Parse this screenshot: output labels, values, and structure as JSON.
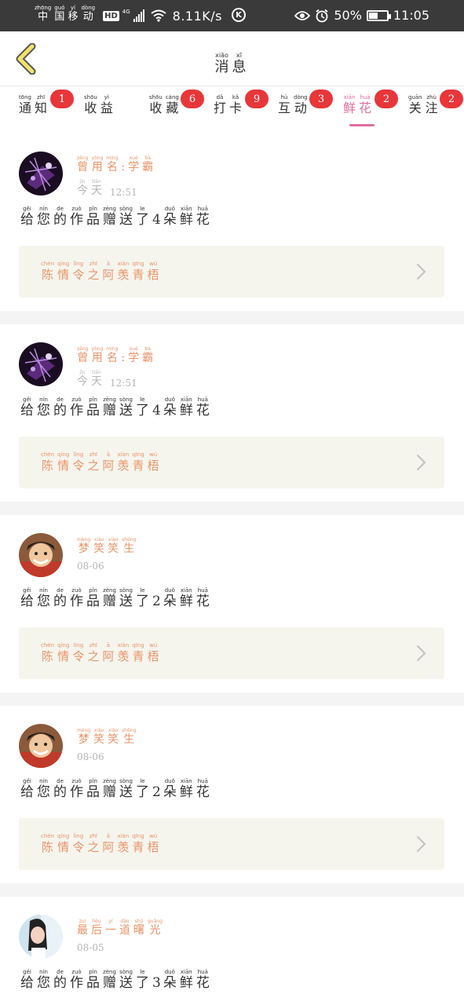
{
  "status_bar": {
    "carrier": [
      {
        "p": "zhōng",
        "h": "中"
      },
      {
        "p": "guó",
        "h": "国"
      },
      {
        "p": "yí",
        "h": "移"
      },
      {
        "p": "dòng",
        "h": "动"
      }
    ],
    "hd": "HD",
    "network": "4G",
    "speed": "8.11K/s",
    "k_icon": "K",
    "battery": "50%",
    "battery_level": 0.5,
    "time": "11:05"
  },
  "header": {
    "title": [
      {
        "p": "xiāo",
        "h": "消"
      },
      {
        "p": "xī",
        "h": "息"
      }
    ]
  },
  "tabs": [
    {
      "chars": [
        {
          "p": "tōng",
          "h": "通"
        },
        {
          "p": "zhī",
          "h": "知"
        }
      ],
      "badge": "1",
      "active": false
    },
    {
      "chars": [
        {
          "p": "shōu",
          "h": "收"
        },
        {
          "p": "yì",
          "h": "益"
        }
      ],
      "badge": "",
      "active": false
    },
    {
      "chars": [
        {
          "p": "shōu",
          "h": "收"
        },
        {
          "p": "cáng",
          "h": "藏"
        }
      ],
      "badge": "6",
      "active": false
    },
    {
      "chars": [
        {
          "p": "dǎ",
          "h": "打"
        },
        {
          "p": "kǎ",
          "h": "卡"
        }
      ],
      "badge": "9",
      "active": false
    },
    {
      "chars": [
        {
          "p": "hù",
          "h": "互"
        },
        {
          "p": "dòng",
          "h": "动"
        }
      ],
      "badge": "3",
      "active": false
    },
    {
      "chars": [
        {
          "p": "xiān",
          "h": "鲜"
        },
        {
          "p": "huā",
          "h": "花"
        }
      ],
      "badge": "2",
      "active": true
    },
    {
      "chars": [
        {
          "p": "guān",
          "h": "关"
        },
        {
          "p": "zhù",
          "h": "注"
        }
      ],
      "badge": "2",
      "active": false
    }
  ],
  "messages": [
    {
      "avatar": "avatar-purple",
      "name": [
        {
          "p": "zēng",
          "h": "曾"
        },
        {
          "p": "yòng",
          "h": "用"
        },
        {
          "p": "míng",
          "h": "名"
        },
        {
          "p": "",
          "h": ":"
        },
        {
          "p": "xué",
          "h": "学"
        },
        {
          "p": "bà",
          "h": "霸"
        }
      ],
      "time_prefix": [
        {
          "p": "jīn",
          "h": "今"
        },
        {
          "p": "tiān",
          "h": "天"
        }
      ],
      "time": "12:51",
      "flowers": "4",
      "work": [
        {
          "p": "chén",
          "h": "陈"
        },
        {
          "p": "qíng",
          "h": "情"
        },
        {
          "p": "lìng",
          "h": "令"
        },
        {
          "p": "zhī",
          "h": "之"
        },
        {
          "p": "ā",
          "h": "阿"
        },
        {
          "p": "xiàn",
          "h": "羡"
        },
        {
          "p": "qīng",
          "h": "青"
        },
        {
          "p": "wú",
          "h": "梧"
        }
      ]
    },
    {
      "avatar": "avatar-purple",
      "name": [
        {
          "p": "zēng",
          "h": "曾"
        },
        {
          "p": "yòng",
          "h": "用"
        },
        {
          "p": "míng",
          "h": "名"
        },
        {
          "p": "",
          "h": ":"
        },
        {
          "p": "xué",
          "h": "学"
        },
        {
          "p": "bà",
          "h": "霸"
        }
      ],
      "time_prefix": [
        {
          "p": "jīn",
          "h": "今"
        },
        {
          "p": "tiān",
          "h": "天"
        }
      ],
      "time": "12:51",
      "flowers": "4",
      "work": [
        {
          "p": "chén",
          "h": "陈"
        },
        {
          "p": "qíng",
          "h": "情"
        },
        {
          "p": "lìng",
          "h": "令"
        },
        {
          "p": "zhī",
          "h": "之"
        },
        {
          "p": "ā",
          "h": "阿"
        },
        {
          "p": "xiàn",
          "h": "羡"
        },
        {
          "p": "qīng",
          "h": "青"
        },
        {
          "p": "wú",
          "h": "梧"
        }
      ]
    },
    {
      "avatar": "avatar-anime",
      "name": [
        {
          "p": "mèng",
          "h": "梦"
        },
        {
          "p": "xiào",
          "h": "笑"
        },
        {
          "p": "xiào",
          "h": "笑"
        },
        {
          "p": "shēng",
          "h": "生"
        }
      ],
      "time_prefix": [],
      "time": "08-06",
      "flowers": "2",
      "work": [
        {
          "p": "chén",
          "h": "陈"
        },
        {
          "p": "qíng",
          "h": "情"
        },
        {
          "p": "lìng",
          "h": "令"
        },
        {
          "p": "zhī",
          "h": "之"
        },
        {
          "p": "ā",
          "h": "阿"
        },
        {
          "p": "xiàn",
          "h": "羡"
        },
        {
          "p": "qīng",
          "h": "青"
        },
        {
          "p": "wú",
          "h": "梧"
        }
      ]
    },
    {
      "avatar": "avatar-anime",
      "name": [
        {
          "p": "mèng",
          "h": "梦"
        },
        {
          "p": "xiào",
          "h": "笑"
        },
        {
          "p": "xiào",
          "h": "笑"
        },
        {
          "p": "shēng",
          "h": "生"
        }
      ],
      "time_prefix": [],
      "time": "08-06",
      "flowers": "2",
      "work": [
        {
          "p": "chén",
          "h": "陈"
        },
        {
          "p": "qíng",
          "h": "情"
        },
        {
          "p": "lìng",
          "h": "令"
        },
        {
          "p": "zhī",
          "h": "之"
        },
        {
          "p": "ā",
          "h": "阿"
        },
        {
          "p": "xiàn",
          "h": "羡"
        },
        {
          "p": "qīng",
          "h": "青"
        },
        {
          "p": "wú",
          "h": "梧"
        }
      ]
    },
    {
      "avatar": "avatar-girl",
      "name": [
        {
          "p": "zuì",
          "h": "最"
        },
        {
          "p": "hòu",
          "h": "后"
        },
        {
          "p": "yí",
          "h": "一"
        },
        {
          "p": "dào",
          "h": "道"
        },
        {
          "p": "shǔ",
          "h": "曙"
        },
        {
          "p": "guāng",
          "h": "光"
        }
      ],
      "time_prefix": [],
      "time": "08-05",
      "flowers": "3",
      "work": []
    }
  ],
  "message_text": {
    "before": [
      {
        "p": "gěi",
        "h": "给"
      },
      {
        "p": "nín",
        "h": "您"
      },
      {
        "p": "de",
        "h": "的"
      },
      {
        "p": "zuò",
        "h": "作"
      },
      {
        "p": "pǐn",
        "h": "品"
      },
      {
        "p": "zèng",
        "h": "赠"
      },
      {
        "p": "sòng",
        "h": "送"
      },
      {
        "p": "le",
        "h": "了"
      }
    ],
    "after": [
      {
        "p": "duǒ",
        "h": "朵"
      },
      {
        "p": "xiān",
        "h": "鲜"
      },
      {
        "p": "huā",
        "h": "花"
      }
    ]
  },
  "colors": {
    "accent_pink": "#e06ea0",
    "badge_red": "#e8363a",
    "name_orange": "#e8946a",
    "link_bg": "#f5f5ee",
    "back_arrow": "#f2e26a"
  }
}
